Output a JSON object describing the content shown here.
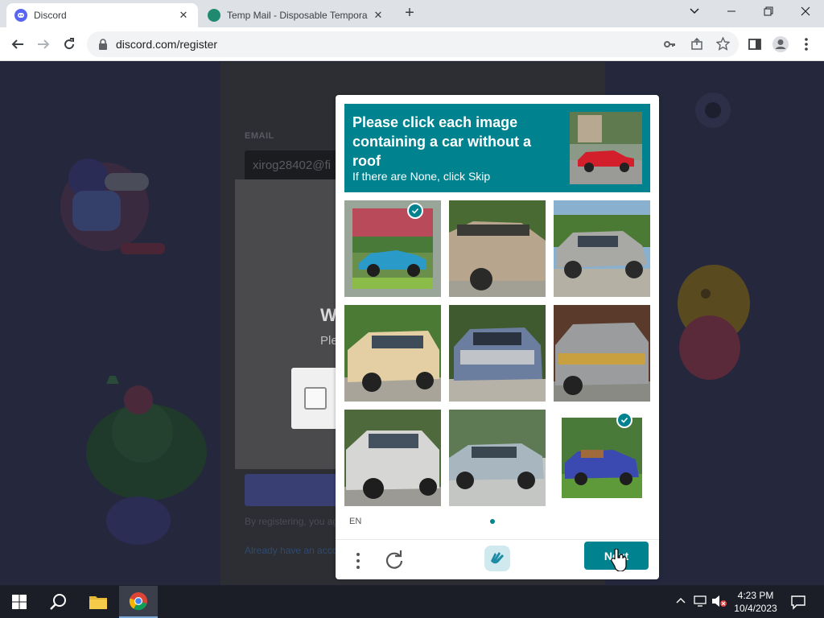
{
  "browser": {
    "tabs": [
      {
        "title": "Discord",
        "active": true
      },
      {
        "title": "Temp Mail - Disposable Tempora",
        "active": false
      }
    ],
    "url": "discord.com/register",
    "window_controls": [
      "chevron-down-icon",
      "minimize-icon",
      "restore-icon",
      "close-icon"
    ]
  },
  "background_page": {
    "email_label": "EMAIL",
    "email_value": "xirog28402@fi",
    "modal_title_partial": "W",
    "modal_sub_partial": "Ple",
    "terms_text": "By registering, you ag",
    "have_account_text": "Already have an accou"
  },
  "captcha": {
    "prompt_title": "Please click each image containing a car without a roof",
    "prompt_hint": "If there are None, click Skip",
    "tiles": [
      {
        "label": "blue convertible in park",
        "selected": true
      },
      {
        "label": "tan sedan close-up",
        "selected": false
      },
      {
        "label": "silver hatchback",
        "selected": false
      },
      {
        "label": "cream station wagon",
        "selected": false
      },
      {
        "label": "blue sedan front",
        "selected": false
      },
      {
        "label": "grey sedan front",
        "selected": false
      },
      {
        "label": "white sedan",
        "selected": false
      },
      {
        "label": "light blue sedan",
        "selected": false
      },
      {
        "label": "blue convertible",
        "selected": true
      }
    ],
    "language": "EN",
    "next_label": "Next",
    "accent": "#00838f"
  },
  "taskbar": {
    "time": "4:23 PM",
    "date": "10/4/2023"
  }
}
